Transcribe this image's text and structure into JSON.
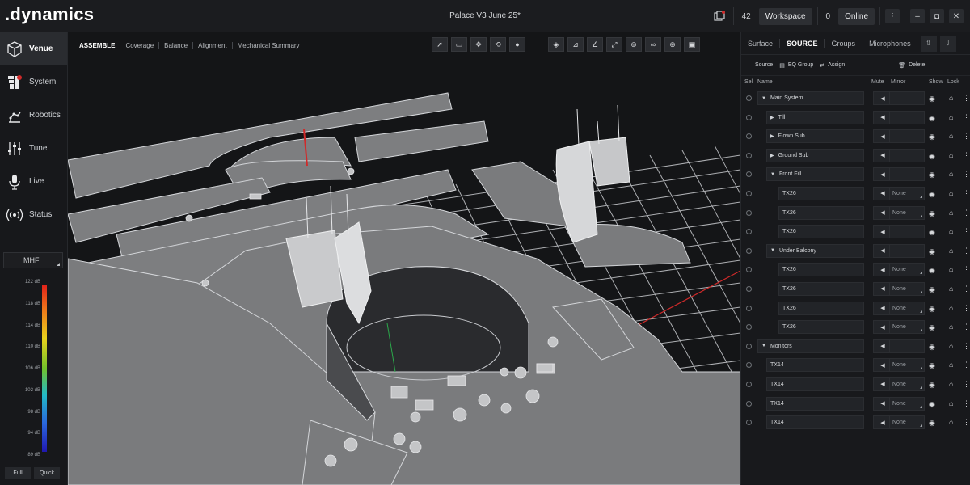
{
  "app": {
    "logo": ".dynamics",
    "project_title": "Palace V3 June 25*"
  },
  "topbar": {
    "workspace_count": "42",
    "workspace_label": "Workspace",
    "online_count": "0",
    "online_label": "Online"
  },
  "sidebar": {
    "items": [
      {
        "label": "Venue",
        "icon": "cube-icon"
      },
      {
        "label": "System",
        "icon": "speaker-array-icon"
      },
      {
        "label": "Robotics",
        "icon": "robot-arm-icon"
      },
      {
        "label": "Tune",
        "icon": "sliders-icon"
      },
      {
        "label": "Live",
        "icon": "microphone-icon"
      },
      {
        "label": "Status",
        "icon": "broadcast-icon"
      }
    ],
    "frequency_select": "MHF",
    "scale_labels": [
      "122 dB",
      "118 dB",
      "114 dB",
      "110 dB",
      "106 dB",
      "102 dB",
      "98 dB",
      "94 dB",
      "89 dB"
    ],
    "scale_buttons": [
      "Full",
      "Quick"
    ]
  },
  "viewport": {
    "subtabs": [
      "ASSEMBLE",
      "Coverage",
      "Balance",
      "Alignment",
      "Mechanical Summary"
    ]
  },
  "rpanel": {
    "tabs": [
      "Surface",
      "SOURCE",
      "Groups",
      "Microphones"
    ],
    "actions": [
      "Source",
      "EQ Group",
      "Assign",
      "Delete"
    ],
    "columns": {
      "sel": "Sel",
      "name": "Name",
      "mute": "Mute",
      "mirror": "Mirror",
      "show": "Show",
      "lock": "Lock"
    },
    "rows": [
      {
        "name": "Main System",
        "mirror": ""
      },
      {
        "name": "Till",
        "mirror": ""
      },
      {
        "name": "Flown Sub",
        "mirror": ""
      },
      {
        "name": "Ground Sub",
        "mirror": ""
      },
      {
        "name": "Front Fill",
        "mirror": ""
      },
      {
        "name": "TX26",
        "mirror": "None"
      },
      {
        "name": "TX26",
        "mirror": "None"
      },
      {
        "name": "TX26",
        "mirror": ""
      },
      {
        "name": "Under Balcony",
        "mirror": ""
      },
      {
        "name": "TX26",
        "mirror": "None"
      },
      {
        "name": "TX26",
        "mirror": "None"
      },
      {
        "name": "TX26",
        "mirror": "None"
      },
      {
        "name": "TX26",
        "mirror": "None"
      },
      {
        "name": "Monitors",
        "mirror": ""
      },
      {
        "name": "TX14",
        "mirror": "None"
      },
      {
        "name": "TX14",
        "mirror": "None"
      },
      {
        "name": "TX14",
        "mirror": "None"
      },
      {
        "name": "TX14",
        "mirror": "None"
      }
    ]
  },
  "colors": {
    "background": "#0d0e10",
    "surface": "#7d7e80",
    "grid": "#cfd1d4",
    "accent_red": "#d02a2a",
    "accent_green": "#2aa84a"
  }
}
